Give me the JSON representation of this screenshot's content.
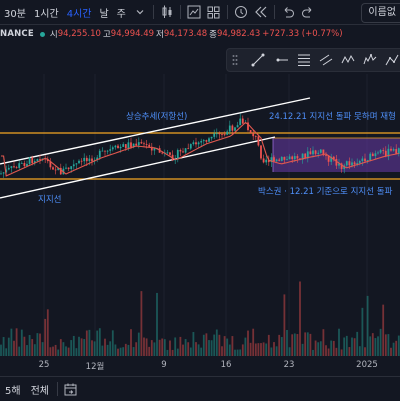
{
  "toolbar": {
    "timeframes": [
      "30분",
      "1시간",
      "4시간"
    ],
    "active_timeframe": "4시간",
    "day_label": "날",
    "week_label": "주",
    "name_button": "이름없"
  },
  "legend": {
    "symbol": "NANCE",
    "open_label": "시",
    "open": "94,255.10",
    "high_label": "고",
    "high": "94,994.49",
    "low_label": "저",
    "low": "94,173.48",
    "close_label": "종",
    "close": "94,982.43",
    "change": "+727.33 (+0.77%)"
  },
  "annotations": {
    "channel": "상승추세(저항선)",
    "support": "지지선",
    "box_top": "24.12.21 지지선 돌파 못하며 재형",
    "box_bottom": "박스권 · 12.21 기준으로 지지선 돌파"
  },
  "xaxis": {
    "labels": [
      "25",
      "12월",
      "9",
      "16",
      "23",
      "2025"
    ]
  },
  "bottombar": {
    "range_5d": "5해",
    "range_all": "전체"
  },
  "colors": {
    "background": "#131722",
    "up": "#26a69a",
    "down": "#ef5350",
    "active": "#2962ff",
    "channel_lines": "#ffffff",
    "box_lines": "#f5a623",
    "box_fill": "#6a3aa8",
    "ma_line": "#e0584f",
    "annotation_text": "#4e8ef7"
  }
}
